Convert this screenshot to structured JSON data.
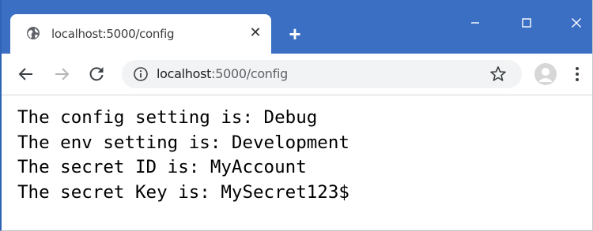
{
  "tab": {
    "title": "localhost:5000/config",
    "close_glyph": "✕"
  },
  "new_tab_glyph": "+",
  "window_controls": {
    "minimize_icon": "minimize-icon",
    "maximize_icon": "maximize-icon",
    "close_icon": "close-icon"
  },
  "toolbar": {
    "url_host": "localhost",
    "url_rest": ":5000/config"
  },
  "content": {
    "lines": [
      "The config setting is: Debug",
      "The env setting is: Development",
      "The secret ID is: MyAccount",
      "The secret Key is: MySecret123$"
    ]
  },
  "colors": {
    "titlebar": "#3a6fc4",
    "tab_background": "#ffffff",
    "omnibox_background": "#f1f3f4"
  }
}
